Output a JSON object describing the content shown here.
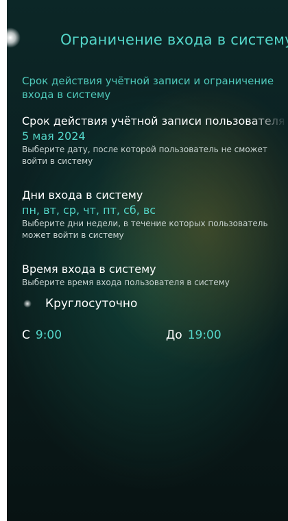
{
  "header": {
    "title": "Ограничение входа в систему"
  },
  "section": {
    "title": "Срок действия учётной записи и ограничение входа в систему"
  },
  "account_expiry": {
    "label": "Срок действия учётной записи пользователя",
    "value": "5 мая 2024",
    "description": "Выберите дату, после которой пользователь не сможет войти в систему"
  },
  "login_days": {
    "label": "Дни входа в систему",
    "value": "пн, вт, ср, чт, пт, сб, вс",
    "description": "Выберите дни недели, в течение которых пользователь может войти в систему"
  },
  "login_time": {
    "label": "Время входа в систему",
    "description": "Выберите время входа пользователя в систему",
    "around_clock_label": "Круглосуточно",
    "from_prefix": "С",
    "from_value": "9:00",
    "to_prefix": "До",
    "to_value": "19:00"
  },
  "colors": {
    "accent": "#54d6c9",
    "text": "#ffffff",
    "muted": "#c9d4d2"
  }
}
